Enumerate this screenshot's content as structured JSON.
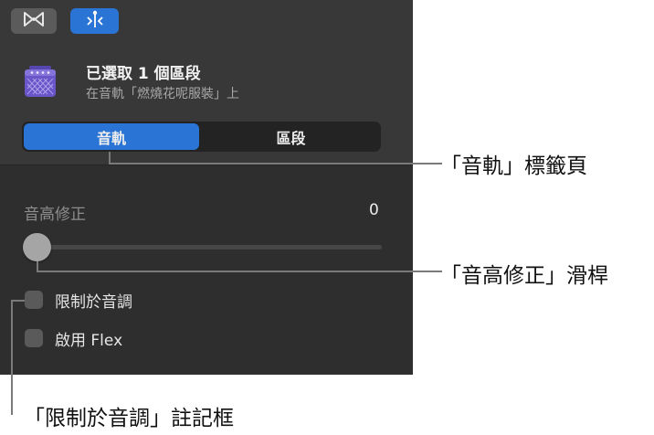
{
  "header": {
    "region_title": "已選取 1 個區段",
    "region_subtitle": "在音軌「燃燒花呢服裝」上"
  },
  "tabs": [
    {
      "label": "音軌",
      "selected": true
    },
    {
      "label": "區段",
      "selected": false
    }
  ],
  "pitch_correction": {
    "label": "音高修正",
    "value": "0"
  },
  "checkboxes": {
    "limit_to_key": {
      "label": "限制於音調",
      "checked": false
    },
    "enable_flex": {
      "label": "啟用 Flex",
      "checked": false
    }
  },
  "callouts": {
    "track_tab": "「音軌」標籤頁",
    "pitch_slider": "「音高修正」滑桿",
    "limit_checkbox": "「限制於音調」註記框"
  },
  "colors": {
    "accent": "#2a74d6",
    "panel_bg": "#2e2e2e",
    "header_bg": "#383838"
  },
  "icons": [
    "tuner-icon",
    "smart-controls-icon",
    "amp-icon"
  ]
}
